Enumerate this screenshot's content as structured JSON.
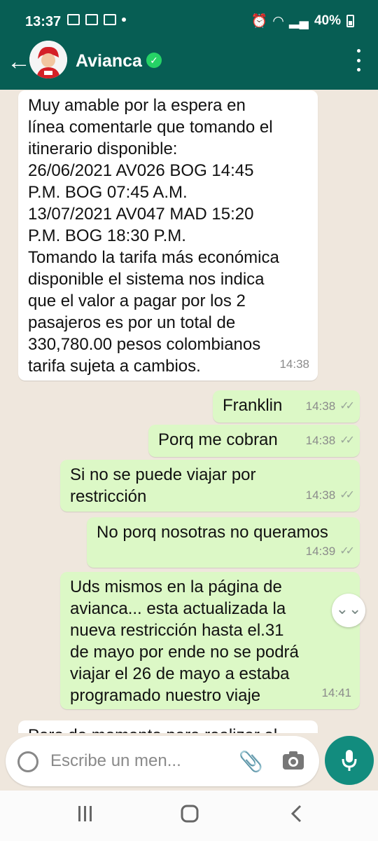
{
  "status_bar": {
    "time": "13:37",
    "battery": "40%"
  },
  "header": {
    "contact_name": "Avianca"
  },
  "messages": [
    {
      "direction": "in",
      "text": "Muy amable por la espera en\nlínea comentarle que tomando el\nitinerario disponible:\n26/06/2021 AV026 BOG 14:45\nP.M. BOG 07:45 A.M.\n13/07/2021 AV047 MAD 15:20\nP.M. BOG 18:30 P.M.\nTomando la tarifa más económica\ndisponible el sistema nos indica\nque el valor a pagar por los 2\npasajeros es por un total de\n330,780.00 pesos colombianos\ntarifa sujeta a cambios.",
      "time": "14:38"
    },
    {
      "direction": "out",
      "text": "Franklin",
      "time": "14:38"
    },
    {
      "direction": "out",
      "text": "Porq me cobran",
      "time": "14:38"
    },
    {
      "direction": "out",
      "text": "Si no se puede viajar por\nrestricción",
      "time": "14:38"
    },
    {
      "direction": "out",
      "text": "No porq nosotras no queramos",
      "time": "14:39"
    },
    {
      "direction": "out",
      "text": "Uds mismos en la página de\navianca... esta actualizada la\nnueva restricción hasta el.31\nde mayo por ende no se podrá\nviajar el 26 de mayo a estaba\nprogramado nuestro viaje",
      "time": "14:41"
    },
    {
      "direction": "in",
      "text": "Pero de momento para realizar el",
      "time": ""
    }
  ],
  "composer": {
    "placeholder": "Escribe un men..."
  },
  "colors": {
    "header": "#075e54",
    "outgoing": "#dcf8c6",
    "incoming": "#ffffff",
    "mic": "#128c7e"
  }
}
